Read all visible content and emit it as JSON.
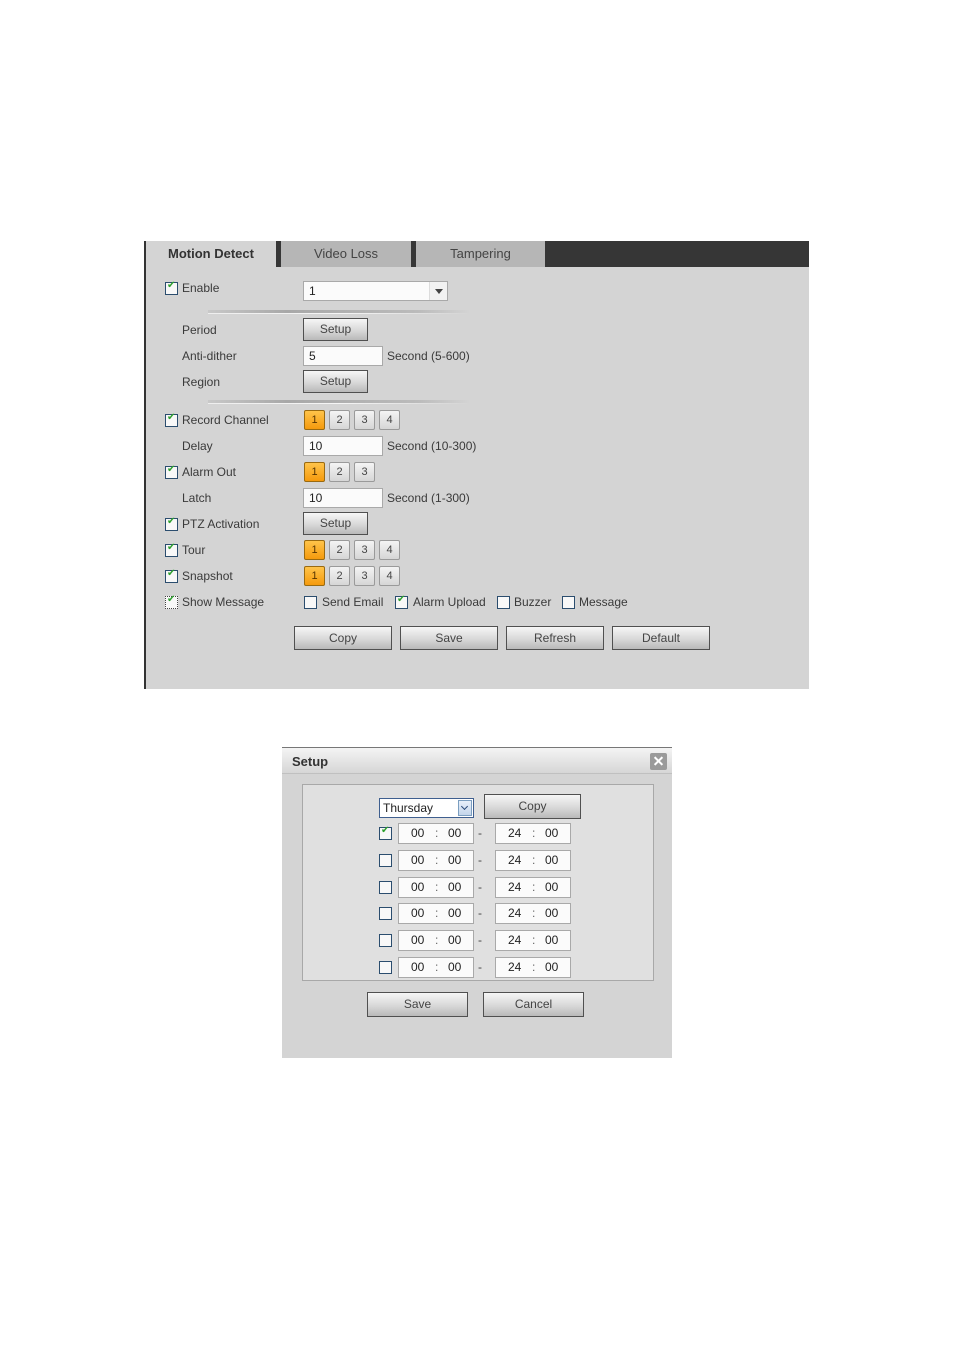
{
  "tabs": [
    {
      "label": "Motion Detect",
      "active": true
    },
    {
      "label": "Video Loss",
      "active": false
    },
    {
      "label": "Tampering",
      "active": false
    }
  ],
  "form": {
    "enable": {
      "label": "Enable",
      "checked": true,
      "channel_value": "1"
    },
    "period": {
      "label": "Period",
      "button": "Setup"
    },
    "anti_dither": {
      "label": "Anti-dither",
      "value": "5",
      "unit": "Second (5-600)"
    },
    "region": {
      "label": "Region",
      "button": "Setup"
    },
    "record_channel": {
      "label": "Record Channel",
      "checked": true,
      "channels": [
        "1",
        "2",
        "3",
        "4"
      ],
      "selected": [
        "1"
      ]
    },
    "delay": {
      "label": "Delay",
      "value": "10",
      "unit": "Second (10-300)"
    },
    "alarm_out": {
      "label": "Alarm Out",
      "checked": true,
      "channels": [
        "1",
        "2",
        "3"
      ],
      "selected": [
        "1"
      ]
    },
    "latch": {
      "label": "Latch",
      "value": "10",
      "unit": "Second (1-300)"
    },
    "ptz_activation": {
      "label": "PTZ Activation",
      "checked": true,
      "button": "Setup"
    },
    "tour": {
      "label": "Tour",
      "checked": true,
      "channels": [
        "1",
        "2",
        "3",
        "4"
      ],
      "selected": [
        "1"
      ]
    },
    "snapshot": {
      "label": "Snapshot",
      "checked": true,
      "channels": [
        "1",
        "2",
        "3",
        "4"
      ],
      "selected": [
        "1"
      ]
    },
    "show_message": {
      "label": "Show Message",
      "checked": true
    },
    "options": [
      {
        "label": "Send Email",
        "checked": false
      },
      {
        "label": "Alarm Upload",
        "checked": true
      },
      {
        "label": "Buzzer",
        "checked": false
      },
      {
        "label": "Message",
        "checked": false
      }
    ]
  },
  "actions": {
    "copy": "Copy",
    "save": "Save",
    "refresh": "Refresh",
    "default": "Default"
  },
  "dialog": {
    "title": "Setup",
    "day": "Thursday",
    "copy": "Copy",
    "periods": [
      {
        "enabled": true,
        "start_h": "00",
        "start_m": "00",
        "end_h": "24",
        "end_m": "00"
      },
      {
        "enabled": false,
        "start_h": "00",
        "start_m": "00",
        "end_h": "24",
        "end_m": "00"
      },
      {
        "enabled": false,
        "start_h": "00",
        "start_m": "00",
        "end_h": "24",
        "end_m": "00"
      },
      {
        "enabled": false,
        "start_h": "00",
        "start_m": "00",
        "end_h": "24",
        "end_m": "00"
      },
      {
        "enabled": false,
        "start_h": "00",
        "start_m": "00",
        "end_h": "24",
        "end_m": "00"
      },
      {
        "enabled": false,
        "start_h": "00",
        "start_m": "00",
        "end_h": "24",
        "end_m": "00"
      }
    ],
    "separator": ":",
    "dash": "-",
    "save": "Save",
    "cancel": "Cancel"
  }
}
